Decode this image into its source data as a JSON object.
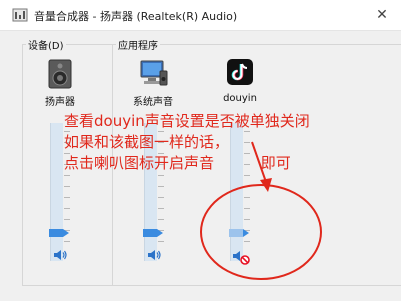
{
  "window": {
    "title": "音量合成器 - 扬声器 (Realtek(R) Audio)",
    "close_glyph": "✕"
  },
  "device_group": {
    "label": "设备(D)",
    "devices": [
      {
        "name": "扬声器",
        "icon": "speaker-device-icon"
      }
    ]
  },
  "app_group": {
    "label": "应用程序",
    "apps": [
      {
        "name": "系统声音",
        "icon": "system-sounds-icon"
      },
      {
        "name": "douyin",
        "icon": "douyin-logo-icon"
      }
    ]
  },
  "channels": [
    {
      "id": "speaker",
      "volume_level": 0.2,
      "muted": false
    },
    {
      "id": "system-sounds",
      "volume_level": 0.2,
      "muted": false
    },
    {
      "id": "douyin",
      "volume_level": 0.2,
      "muted": true
    }
  ],
  "annotation": {
    "line1": "查看douyin声音设置是否被单独关闭",
    "line2": "如果和该截图一样的话，",
    "line3": "点击喇叭图标开启声音",
    "line3_tail": "即可"
  },
  "colors": {
    "annotation_red": "#e0281c",
    "slider_blue": "#3a8be0",
    "mute_red": "#e81123"
  }
}
